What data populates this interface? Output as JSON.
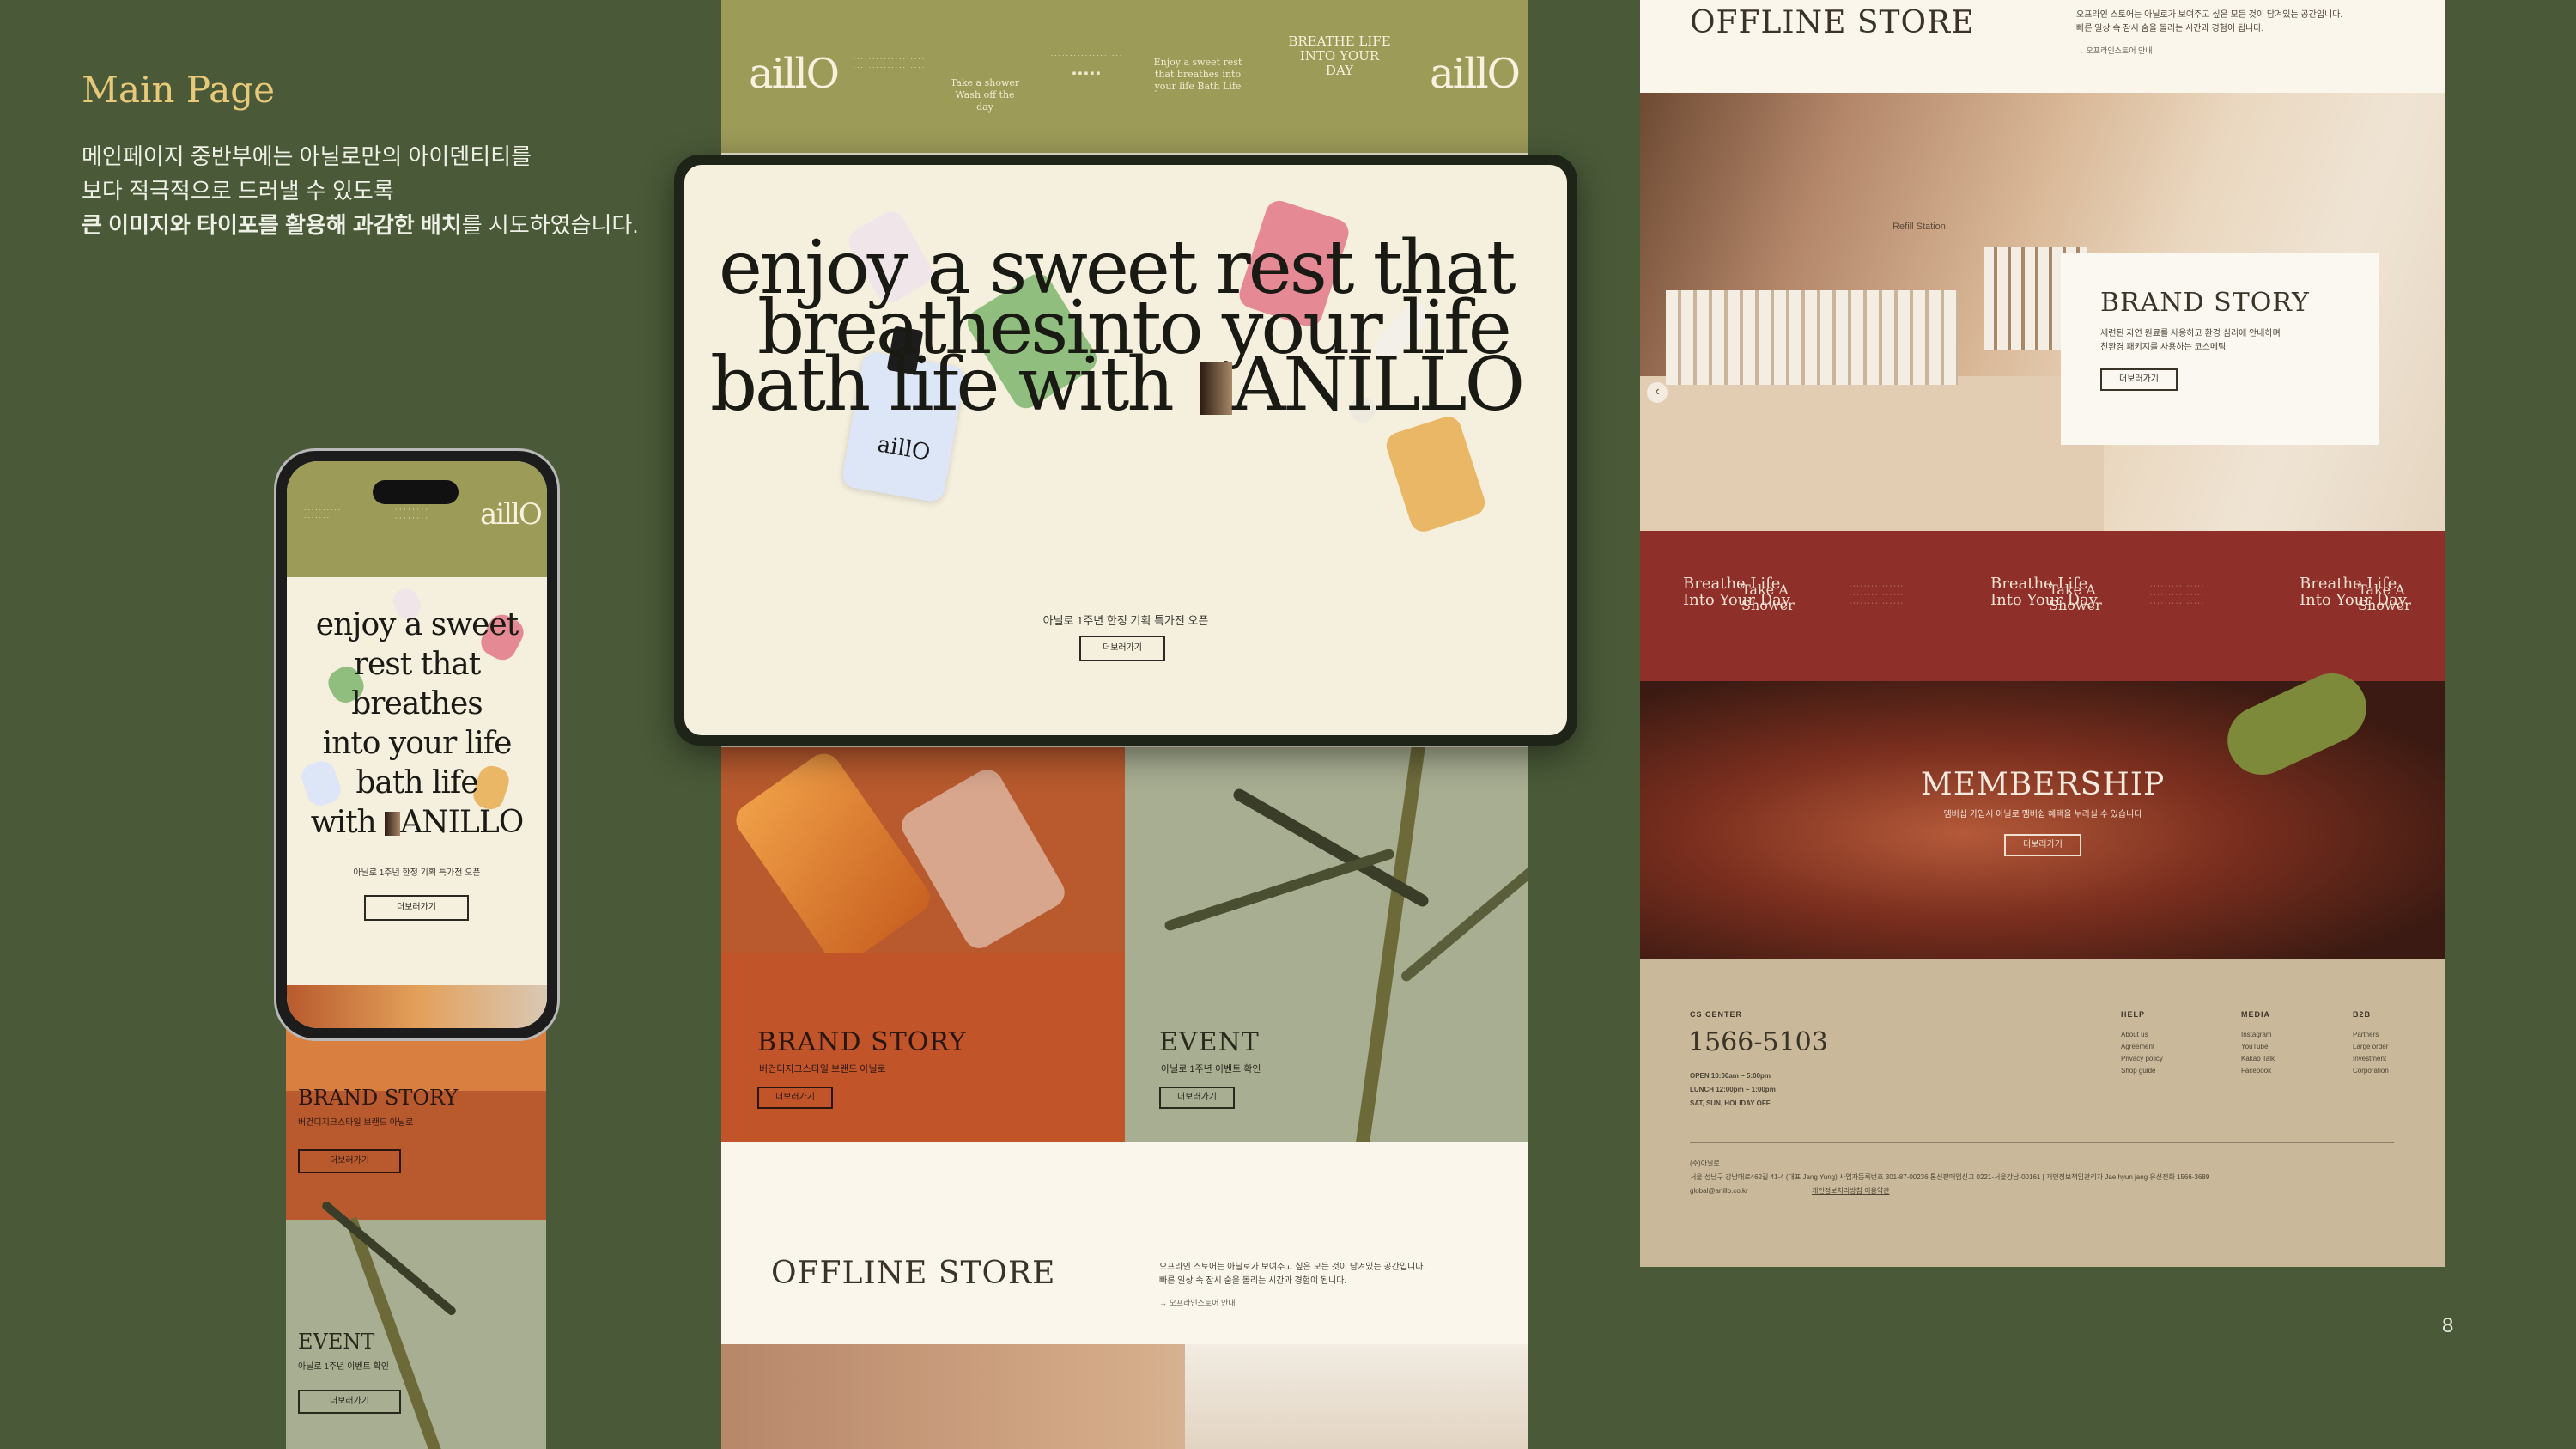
{
  "intro": {
    "title": "Main Page",
    "line1": "메인페이지 중반부에는 아닐로만의 아이덴티티를",
    "line2": "보다 적극적으로 드러낼 수 있도록",
    "line3_bold": "큰 이미지와 타이포를 활용해 과감한 배치",
    "line3_rest": "를 시도하였습니다."
  },
  "page_number": "8",
  "brand": {
    "logo": "aillO",
    "wordmark": "ANILLO"
  },
  "top_strip": {
    "tagline_take": "Take a shower Wash off the day",
    "tagline_enjoy": "Enjoy a sweet rest that breathes into your life Bath Life",
    "tagline_breathe": "BREATHE LIFE INTO YOUR DAY"
  },
  "hero": {
    "line1": "enjoy a sweet rest that",
    "line2": "breathesinto your life",
    "line3": "bath life with",
    "subtitle": "아닐로 1주년 한정 기획 특가전 오픈",
    "button": "더보러가기"
  },
  "phone": {
    "hero_lines": [
      "enjoy a sweet",
      "rest that",
      "breathes",
      "into your life",
      "bath life",
      "with"
    ],
    "subtitle": "아닐로 1주년 한정 기획 특가전 오픈",
    "button": "더보러가기",
    "brand_title": "BRAND STORY",
    "brand_sub": "버건디지크스타일 브랜드 아닐로",
    "brand_button": "더보러가기",
    "event_title": "EVENT",
    "event_sub": "아닐로 1주년 이벤트 확인",
    "event_button": "더보러가기"
  },
  "tiles": {
    "brand_title": "BRAND STORY",
    "brand_sub": "버건디지크스타일 브랜드 아닐로",
    "brand_button": "더보러가기",
    "event_title": "EVENT",
    "event_sub": "아닐로 1주년 이벤트 확인",
    "event_button": "더보러가기"
  },
  "offline": {
    "title": "OFFLINE STORE",
    "desc1": "오프라인 스토어는 아닐로가 보여주고 싶은 모든 것이 담겨있는 공간입니다.",
    "desc2": "빠른 일상 속 잠시 숨을 돌리는 시간과 경험이 됩니다.",
    "link": "오프라인스토어 안내"
  },
  "right": {
    "offline_title": "OFFLINE STORE",
    "offline_desc1": "오프라인 스토어는 아닐로가 보여주고 싶은 모든 것이 담겨있는 공간입니다.",
    "offline_desc2": "빠른 일상 속 잠시 숨을 돌리는 시간과 경험이 됩니다.",
    "offline_link": "오프라인스토어 안내",
    "store_sign": "Refill Station",
    "brand_story_title": "BRAND STORY",
    "brand_story_desc1": "세련된 자연 원료를 사용하고 환경 심리에 안내하며",
    "brand_story_desc2": "친환경 패키지를 사용하는 코스메틱",
    "brand_story_button": "더보러가기",
    "band_phrase": "Breathe Life Into Your Day",
    "band_phrase2": "Take A Shower",
    "membership_title": "MEMBERSHIP",
    "membership_sub": "멤버십 가입시 아닐로 멤버쉽 혜택을 누리실 수 있습니다",
    "membership_button": "더보러가기"
  },
  "footer": {
    "cs_label": "CS CENTER",
    "phone": "1566-5103",
    "open": "OPEN 10:00am ~ 5:00pm",
    "lunch": "LUNCH 12:00pm ~ 1:00pm",
    "holiday": "SAT, SUN, HOLIDAY OFF",
    "help_label": "HELP",
    "help_items": [
      "About us",
      "Agreement",
      "Privacy policy",
      "Shop guide"
    ],
    "media_label": "MEDIA",
    "media_items": [
      "Instagram",
      "YouTube",
      "Kakao Talk",
      "Facebook"
    ],
    "b2b_label": "B2B",
    "b2b_items": [
      "Partners",
      "Large order",
      "Investment",
      "Corporation"
    ],
    "company_label": "(주)아닐로",
    "company_info": "서울 성남구 강남대로462길 41-4 (대표 Jang Yung) 사업자등록번호 301-87-00236 통신판매업신고 0221-서울강남-00161 | 개인정보책임관리자 Jae hyun jang 유선전화 1566-3689",
    "company_email": "global@anillo.co.kr",
    "company_link": "개인정보처리방침 이용약관"
  },
  "colors": {
    "background": "#4a5a38",
    "olive": "#9c9b58",
    "cream": "#f5efde",
    "burgundy": "#8e2f2a",
    "terracotta": "#b85a2e",
    "accent_gold": "#e8c97a"
  }
}
